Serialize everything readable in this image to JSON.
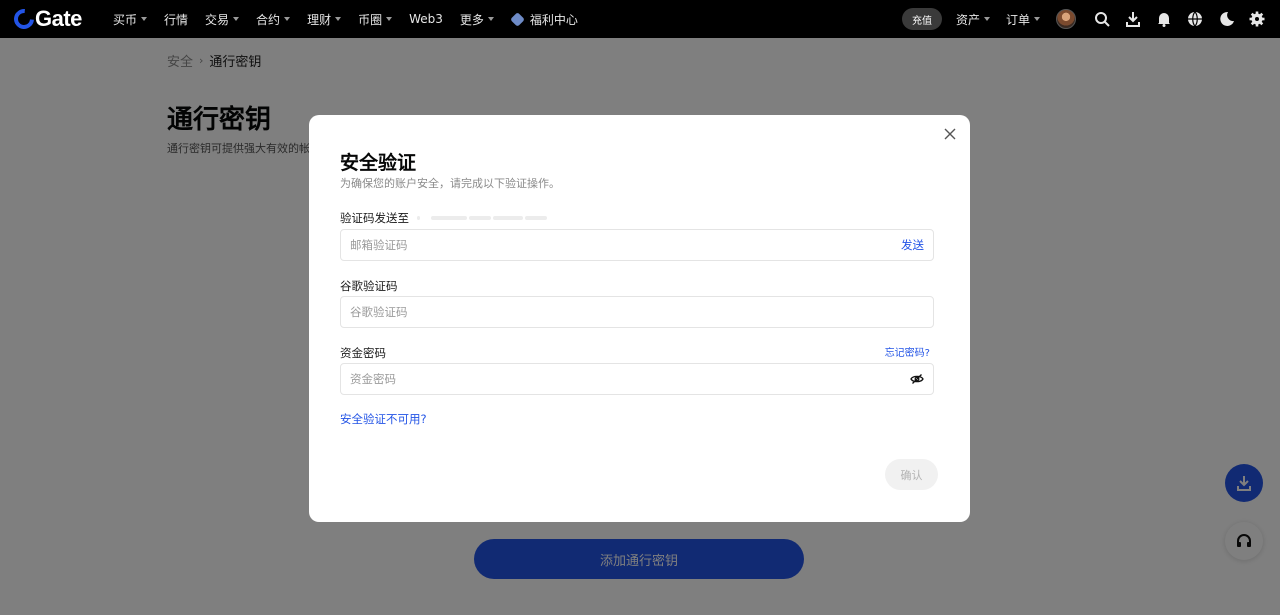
{
  "nav": {
    "logo": "Gate",
    "items": [
      {
        "label": "买币",
        "caret": true
      },
      {
        "label": "行情",
        "caret": false
      },
      {
        "label": "交易",
        "caret": true
      },
      {
        "label": "合约",
        "caret": true
      },
      {
        "label": "理财",
        "caret": true
      },
      {
        "label": "币圈",
        "caret": true
      },
      {
        "label": "Web3",
        "caret": false
      },
      {
        "label": "更多",
        "caret": true
      },
      {
        "label": "福利中心",
        "caret": false
      }
    ],
    "deposit": "充值",
    "assets": "资产",
    "orders": "订单",
    "icons": [
      "search-icon",
      "download-icon",
      "bell-icon",
      "globe-icon",
      "moon-icon",
      "gear-icon"
    ]
  },
  "page": {
    "breadcrumb": {
      "parent": "安全",
      "current": "通行密钥"
    },
    "title": "通行密钥",
    "desc": "通行密钥可提供强大有效的帐",
    "add_button": "添加通行密钥"
  },
  "modal": {
    "title": "安全验证",
    "subtitle": "为确保您的账户安全，请完成以下验证操作。",
    "email_label": "验证码发送至",
    "email_placeholder": "邮箱验证码",
    "send": "发送",
    "google_label": "谷歌验证码",
    "google_placeholder": "谷歌验证码",
    "fund_label": "资金密码",
    "forgot": "忘记密码?",
    "fund_placeholder": "资金密码",
    "unavailable": "安全验证不可用?",
    "confirm": "确认"
  },
  "colors": {
    "accent": "#2354e6",
    "topbar": "#000000",
    "overlay": "rgba(0,0,0,0.5)"
  }
}
